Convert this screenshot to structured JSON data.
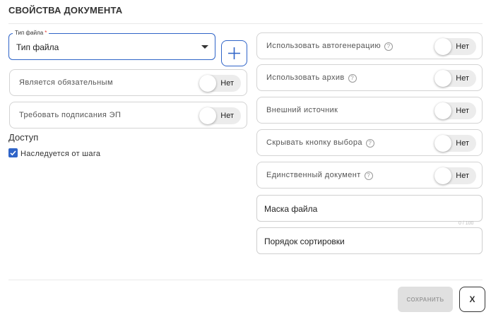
{
  "header": {
    "title": "СВОЙСТВА ДОКУМЕНТА"
  },
  "file_type": {
    "legend": "Тип файла",
    "required_mark": "*",
    "value": "Тип файла"
  },
  "add_button": {
    "icon": "plus-icon"
  },
  "left_fields": [
    {
      "label": "Является обязательным",
      "toggle": "Нет"
    },
    {
      "label": "Требовать подписания ЭП",
      "toggle": "Нет"
    }
  ],
  "access": {
    "heading": "Доступ",
    "inherit_label": "Наследуется от шага",
    "inherit_checked": true
  },
  "right_fields": [
    {
      "label": "Использовать автогенерацию",
      "help": "?",
      "toggle": "Нет"
    },
    {
      "label": "Использовать архив",
      "help": "?",
      "toggle": "Нет"
    },
    {
      "label": "Внешний источник",
      "toggle": "Нет"
    },
    {
      "label": "Скрывать кнопку выбора",
      "help": "?",
      "toggle": "Нет"
    },
    {
      "label": "Единственный документ",
      "help": "?",
      "toggle": "Нет"
    }
  ],
  "mask_input": {
    "placeholder": "Маска файла",
    "counter": "0 / 100"
  },
  "sort_input": {
    "placeholder": "Порядок сортировки"
  },
  "footer": {
    "save_label": "СОХРАНИТЬ",
    "close_label": "X"
  },
  "colors": {
    "accent": "#2f64c8",
    "required": "#e53935",
    "toggle_track": "#ececec",
    "disabled_button": "#e0e0e0"
  }
}
